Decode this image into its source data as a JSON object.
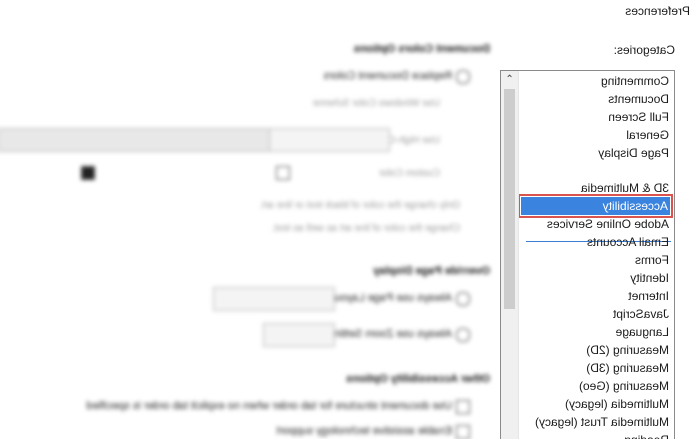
{
  "window": {
    "title": "Preferences"
  },
  "categories": {
    "label": "Categories:",
    "top_items": [
      "Commenting",
      "Documents",
      "Full Screen",
      "General",
      "Page Display"
    ],
    "items": [
      "3D & Multimedia",
      "Accessibility",
      "Adobe Online Services",
      "Email Accounts",
      "Forms",
      "Identity",
      "Internet",
      "JavaScript",
      "Language",
      "Measuring (2D)",
      "Measuring (3D)",
      "Measuring (Geo)",
      "Multimedia (legacy)",
      "Multimedia Trust (legacy)",
      "Reading"
    ],
    "selected": "Accessibility"
  },
  "pane": {
    "document_colors_heading": "Document Colors Options",
    "replace_colors": "Replace Document Colors",
    "windows_scheme": "Use Windows Color Scheme",
    "high_contrast": "Use High-Contrast colors",
    "custom_color": "Custom Color",
    "only_black_text": "Only change the color of black text or line art.",
    "change_line_art": "Change the color of line art as well as text.",
    "override_heading": "Override Page Display",
    "page_layout": "Always use Page Layout Style",
    "zoom_setting": "Always use Zoom Setting",
    "other_heading": "Other Accessibility Options",
    "tab_order": "Use document structure for tab order when no explicit tab order is specified",
    "assistive": "Enable assistive technology support"
  },
  "colors": {
    "selection": "#3a84e0",
    "highlight_outline": "#d9534f",
    "divider": "#3a7fd4"
  }
}
